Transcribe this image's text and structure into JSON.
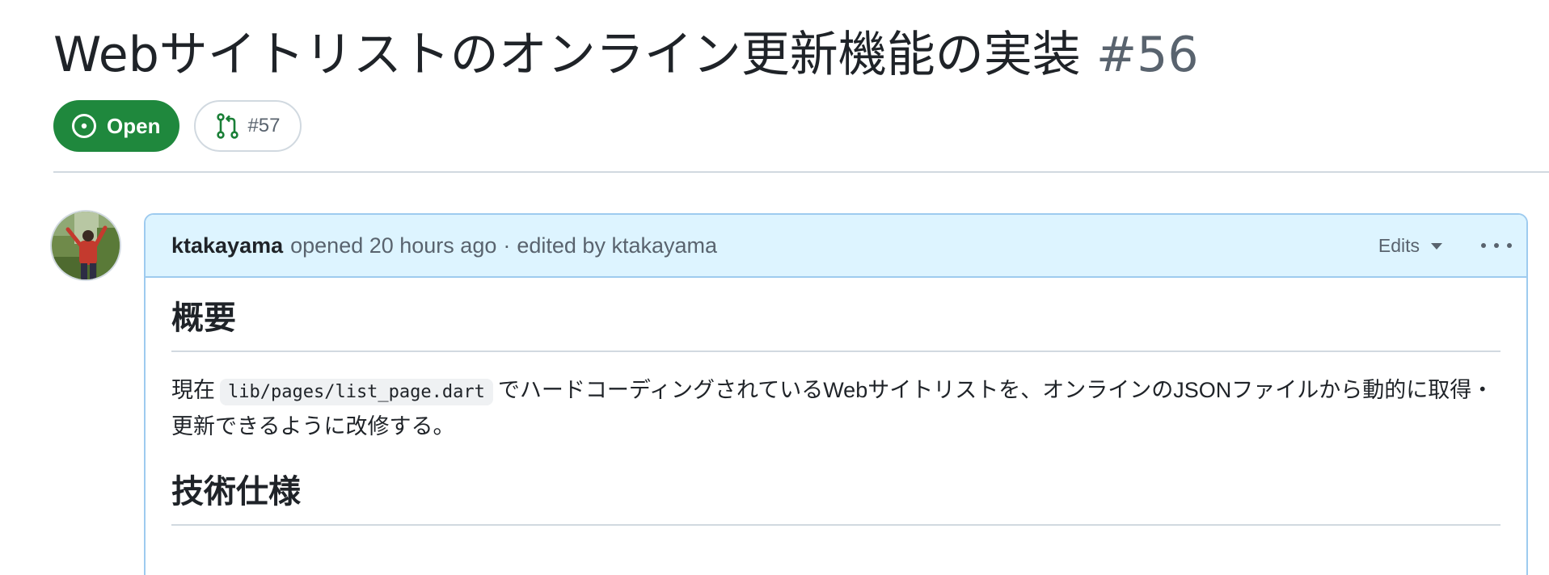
{
  "issue": {
    "title": "Webサイトリストのオンライン更新機能の実装",
    "number": "#56",
    "state_label": "Open",
    "linked_pr": "#57"
  },
  "comment": {
    "author": "ktakayama",
    "opened_text": "opened 20 hours ago",
    "separator": "·",
    "edited_text": "edited by ktakayama",
    "edits_label": "Edits",
    "body": {
      "overview_heading": "概要",
      "paragraph_prefix": "現在",
      "code_path": "lib/pages/list_page.dart",
      "paragraph_suffix": "でハードコーディングされているWebサイトリストを、オンラインのJSONファイルから動的に取得・更新できるように改修する。",
      "spec_heading": "技術仕様"
    }
  },
  "icons": {
    "state": "issue-opened-icon",
    "pr": "git-pull-request-icon",
    "menu": "kebab-horizontal-icon",
    "dropdown": "triangle-down-icon"
  },
  "colors": {
    "open_green": "#1f883d",
    "header_bg": "#ddf4ff",
    "header_border": "#9ecbef",
    "muted_text": "#59636e",
    "divider": "#d1d9e0"
  }
}
